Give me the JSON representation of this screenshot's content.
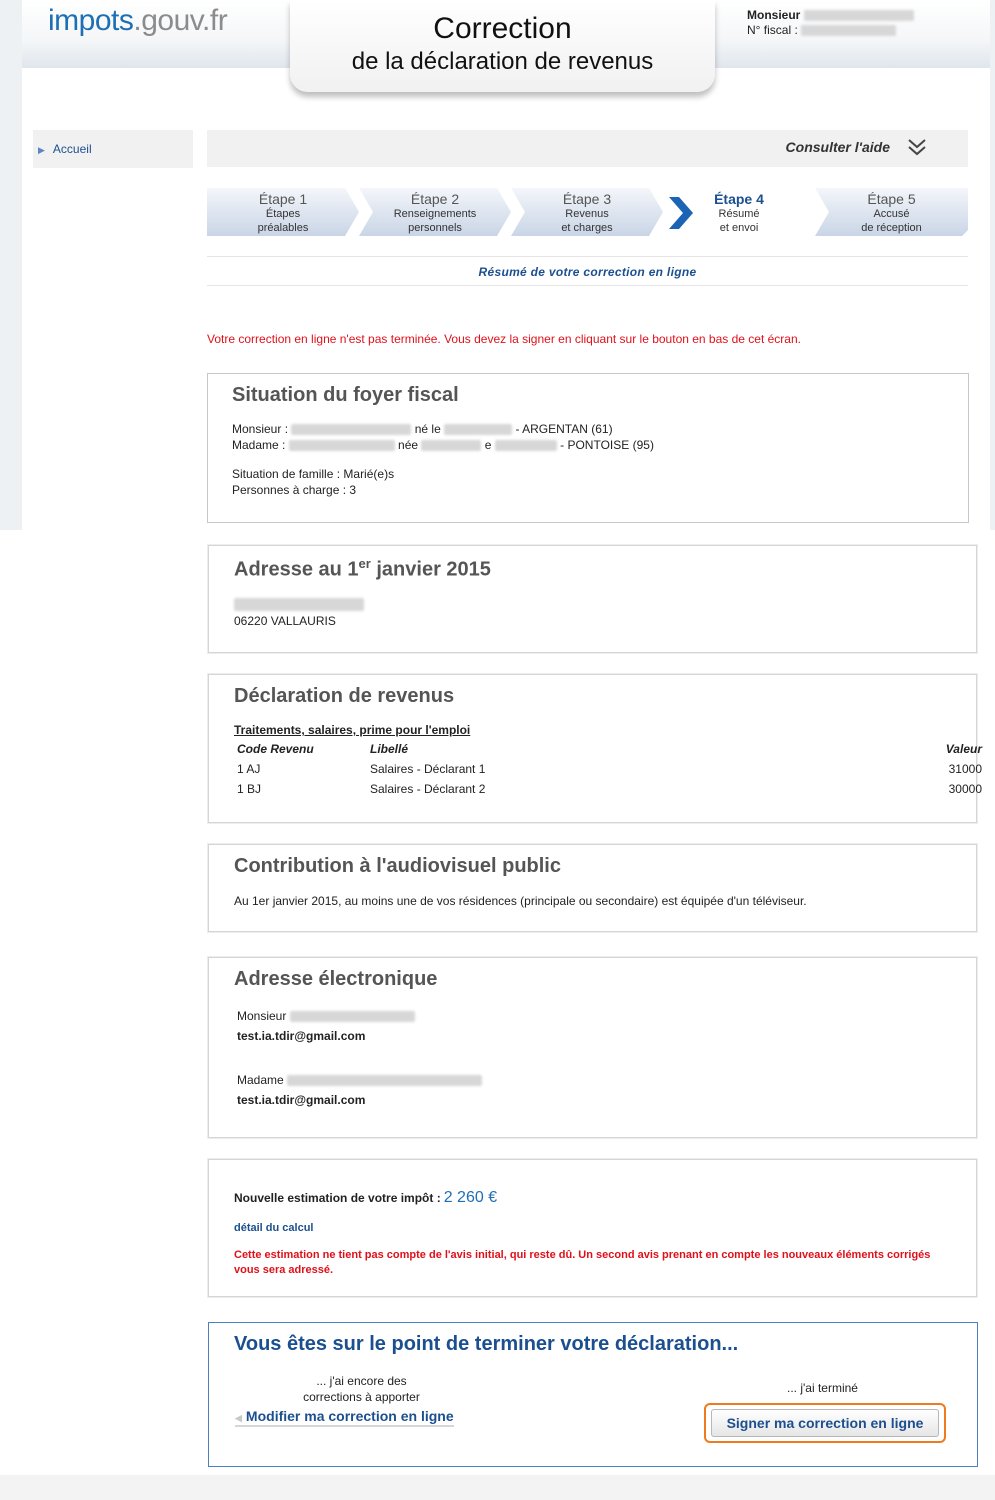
{
  "logo": {
    "part1": "impots",
    "part2": ".gouv.fr"
  },
  "title": {
    "main": "Correction",
    "sub": "de la déclaration de revenus"
  },
  "user": {
    "name_label": "Monsieur",
    "fiscal_label": "N° fiscal :"
  },
  "sidebar": {
    "home": "Accueil"
  },
  "help": {
    "label": "Consulter l'aide"
  },
  "steps": [
    {
      "num": "Étape 1",
      "line1": "Étapes",
      "line2": "préalables"
    },
    {
      "num": "Étape 2",
      "line1": "Renseignements",
      "line2": "personnels"
    },
    {
      "num": "Étape 3",
      "line1": "Revenus",
      "line2": "et charges"
    },
    {
      "num": "Étape 4",
      "line1": "Résumé",
      "line2": "et envoi"
    },
    {
      "num": "Étape 5",
      "line1": "Accusé",
      "line2": "de réception"
    }
  ],
  "summary_title": "Résumé de votre correction en ligne",
  "warning_top": "Votre correction en ligne n'est pas terminée. Vous devez la signer en cliquant sur le bouton en bas de cet écran.",
  "foyer": {
    "title": "Situation du foyer fiscal",
    "monsieur_label": "Monsieur :",
    "ne_le": "né le",
    "monsieur_place": "- ARGENTAN (61)",
    "madame_label": "Madame :",
    "nee": "née",
    "e_fragment": "e",
    "madame_place": "- PONTOISE (95)",
    "family": "Situation de famille : Marié(e)s",
    "dependents": "Personnes à charge : 3"
  },
  "address": {
    "title_prefix": "Adresse au 1",
    "title_sup": "er",
    "title_suffix": " janvier 2015",
    "city": "06220 VALLAURIS"
  },
  "declaration": {
    "title": "Déclaration de revenus",
    "section": "Traitements, salaires, prime pour l'emploi",
    "headers": {
      "code": "Code Revenu",
      "label": "Libellé",
      "value": "Valeur"
    },
    "rows": [
      {
        "code": "1 AJ",
        "label": "Salaires - Déclarant 1",
        "value": "31000"
      },
      {
        "code": "1 BJ",
        "label": "Salaires - Déclarant 2",
        "value": "30000"
      }
    ]
  },
  "audiovisuel": {
    "title": "Contribution à l'audiovisuel public",
    "text": "Au 1er janvier 2015, au moins une de vos résidences (principale ou secondaire) est équipée d'un téléviseur."
  },
  "email": {
    "title": "Adresse électronique",
    "monsieur_label": "Monsieur",
    "monsieur_email": "test.ia.tdir@gmail.com",
    "madame_label": "Madame",
    "madame_email": "test.ia.tdir@gmail.com"
  },
  "estimation": {
    "label": "Nouvelle estimation de votre impôt :",
    "value": "2 260 €",
    "detail_link": "détail du calcul",
    "warning": "Cette estimation ne tient pas compte de l'avis initial, qui reste dû. Un second avis prenant en compte les nouveaux éléments corrigés vous sera adressé."
  },
  "final": {
    "title": "Vous êtes sur le point de terminer votre déclaration...",
    "still_line1": "... j'ai encore des",
    "still_line2": "corrections à apporter",
    "modify_link": "Modifier ma correction en ligne",
    "done_text": "... j'ai terminé",
    "sign_button": "Signer ma correction en ligne"
  },
  "colors": {
    "brand_blue": "#1c4f8f",
    "logo_blue": "#1f6fb5",
    "alert_red": "#e0101a",
    "highlight_orange": "#f07a1e"
  }
}
